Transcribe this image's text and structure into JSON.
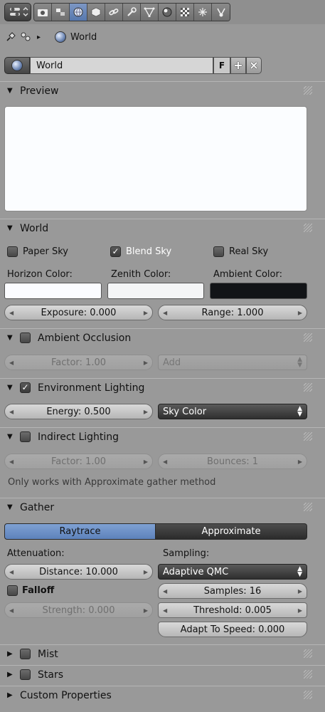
{
  "breadcrumb": {
    "label": "World"
  },
  "datablock": {
    "name": "World",
    "fake_user": "F",
    "add_symbol": "+",
    "remove_symbol": "×"
  },
  "panels": {
    "preview": {
      "title": "Preview"
    },
    "world": {
      "title": "World",
      "paper_sky": "Paper Sky",
      "blend_sky": "Blend Sky",
      "real_sky": "Real Sky",
      "horizon_label": "Horizon Color:",
      "zenith_label": "Zenith Color:",
      "ambient_label": "Ambient Color:",
      "exposure": "Exposure: 0.000",
      "range": "Range: 1.000",
      "colors": {
        "horizon": "#fbfcff",
        "zenith": "#f4f5f6",
        "ambient": "#121417"
      }
    },
    "ambient_occlusion": {
      "title": "Ambient Occlusion",
      "factor": "Factor: 1.00",
      "blend": "Add"
    },
    "environment_lighting": {
      "title": "Environment Lighting",
      "energy": "Energy: 0.500",
      "source": "Sky Color"
    },
    "indirect_lighting": {
      "title": "Indirect Lighting",
      "factor": "Factor: 1.00",
      "bounces": "Bounces: 1",
      "note": "Only works with Approximate gather method"
    },
    "gather": {
      "title": "Gather",
      "raytrace": "Raytrace",
      "approximate": "Approximate",
      "attenuation_label": "Attenuation:",
      "distance": "Distance: 10.000",
      "falloff": "Falloff",
      "strength": "Strength: 0.000",
      "sampling_label": "Sampling:",
      "sampling_method": "Adaptive QMC",
      "samples": "Samples: 16",
      "threshold": "Threshold: 0.005",
      "adapt_to_speed": "Adapt To Speed: 0.000",
      "accent": "#6a8fc6"
    },
    "mist": {
      "title": "Mist"
    },
    "stars": {
      "title": "Stars"
    },
    "custom_properties": {
      "title": "Custom Properties"
    }
  },
  "toolbar_icons": [
    "render-icon",
    "render-layers-icon",
    "scene-icon",
    "world-icon",
    "object-icon",
    "constraints-icon",
    "modifiers-icon",
    "data-icon",
    "material-icon",
    "texture-icon",
    "particles-icon",
    "physics-icon"
  ]
}
